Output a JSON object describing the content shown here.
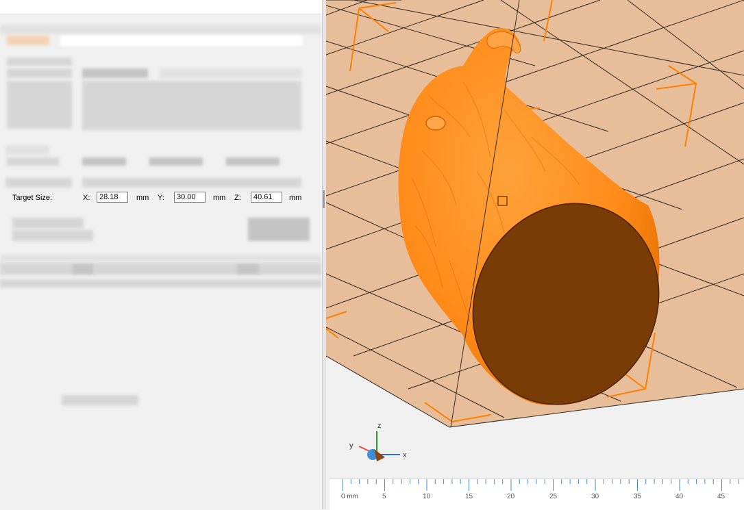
{
  "scale_panel": {
    "target_size_label": "Target Size:",
    "x_label": "X:",
    "x_value": "28.18",
    "x_unit": "mm",
    "y_label": "Y:",
    "y_value": "30.00",
    "y_unit": "mm",
    "z_label": "Z:",
    "z_value": "40.61",
    "z_unit": "mm"
  },
  "triad": {
    "x": "x",
    "y": "y",
    "z": "z"
  },
  "ruler": {
    "unit_label": "0 mm",
    "ticks": [
      "5",
      "10",
      "15",
      "20",
      "25",
      "30",
      "35",
      "40",
      "45"
    ]
  },
  "colors": {
    "model": "#ff8c1a",
    "model_cut_face": "#7a3c07",
    "build_plate": "#e7bd9a",
    "bbox": "#ff7f00"
  },
  "icons": [
    "model-eagle-head",
    "axis-triad-icon"
  ]
}
